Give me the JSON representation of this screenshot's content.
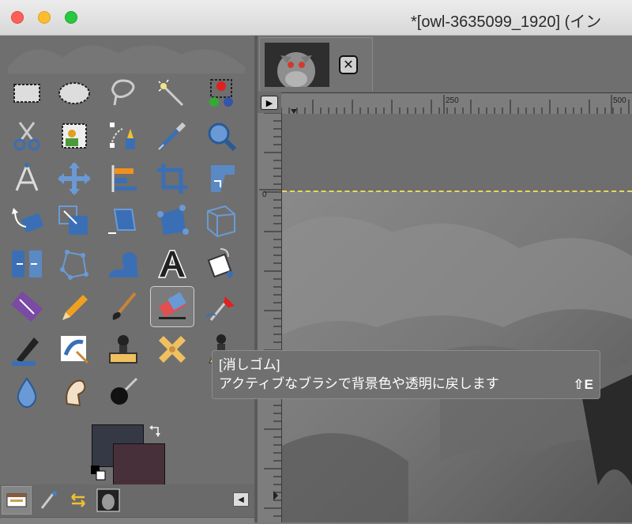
{
  "window": {
    "title": "*[owl-3635099_1920] (イン",
    "controls": [
      "close",
      "minimize",
      "zoom"
    ]
  },
  "toolbox": {
    "tools": [
      {
        "name": "rect-select-icon"
      },
      {
        "name": "ellipse-select-icon"
      },
      {
        "name": "free-select-icon"
      },
      {
        "name": "fuzzy-select-icon"
      },
      {
        "name": "color-select-icon"
      },
      {
        "name": "scissors-select-icon"
      },
      {
        "name": "foreground-select-icon"
      },
      {
        "name": "paths-icon"
      },
      {
        "name": "color-picker-icon"
      },
      {
        "name": "zoom-icon"
      },
      {
        "name": "measure-icon"
      },
      {
        "name": "move-icon"
      },
      {
        "name": "align-icon"
      },
      {
        "name": "crop-icon"
      },
      {
        "name": "unified-transform-icon"
      },
      {
        "name": "rotate-icon"
      },
      {
        "name": "scale-icon"
      },
      {
        "name": "shear-icon"
      },
      {
        "name": "handle-transform-icon"
      },
      {
        "name": "perspective-icon"
      },
      {
        "name": "flip-icon"
      },
      {
        "name": "cage-transform-icon"
      },
      {
        "name": "warp-transform-icon"
      },
      {
        "name": "text-icon"
      },
      {
        "name": "bucket-fill-icon"
      },
      {
        "name": "gradient-icon"
      },
      {
        "name": "pencil-icon"
      },
      {
        "name": "paintbrush-icon"
      },
      {
        "name": "eraser-icon"
      },
      {
        "name": "airbrush-icon"
      },
      {
        "name": "ink-icon"
      },
      {
        "name": "mypaint-brush-icon"
      },
      {
        "name": "clone-icon"
      },
      {
        "name": "heal-icon"
      },
      {
        "name": "perspective-clone-icon"
      },
      {
        "name": "blur-sharpen-icon"
      },
      {
        "name": "smudge-icon"
      },
      {
        "name": "dodge-burn-icon"
      }
    ],
    "active_tool": "eraser-icon",
    "foreground_color": "#353845",
    "background_color": "#48303a",
    "dock_tabs": [
      "tool-options-icon",
      "brushes-icon",
      "undo-history-icon",
      "images-icon"
    ]
  },
  "image_tab": {
    "thumbnail": "owl-thumbnail"
  },
  "ruler": {
    "labels": [
      "250",
      "500"
    ],
    "vertical_label": "0"
  },
  "tooltip": {
    "title": "[消しゴム]",
    "description": "アクティブなブラシで背景色や透明に戻します",
    "shortcut": "⇧E"
  }
}
